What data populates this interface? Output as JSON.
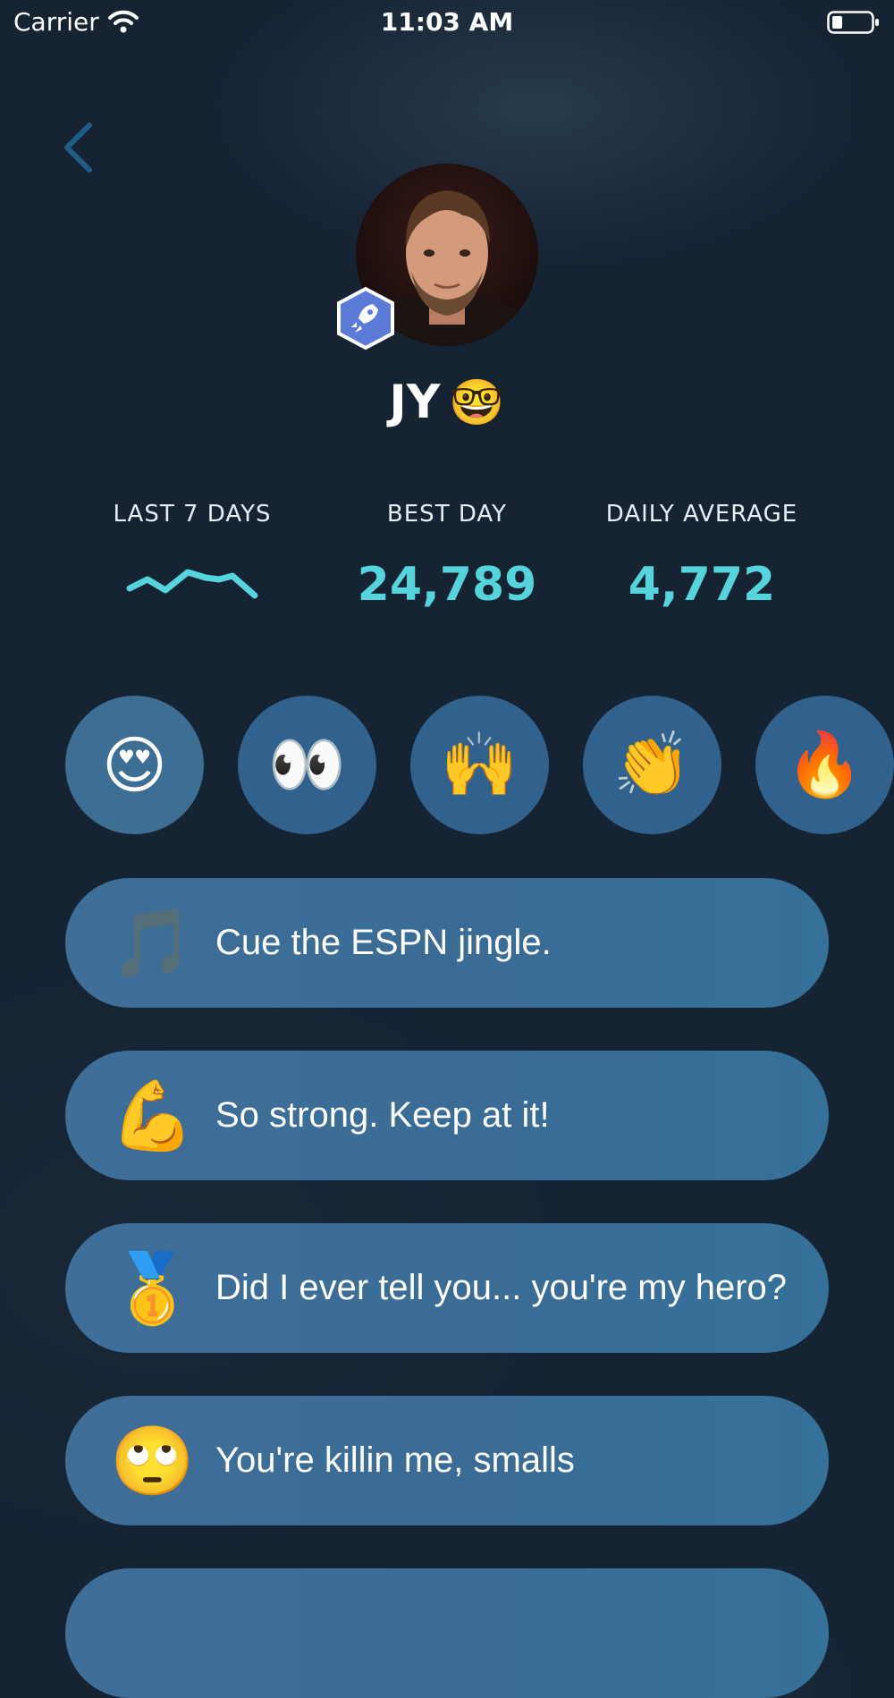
{
  "status_bar": {
    "carrier": "Carrier",
    "time": "11:03 AM"
  },
  "icons": {
    "back": "chevron-left-icon",
    "wifi": "wifi-icon",
    "battery": "battery-icon",
    "badge": "rocket-icon"
  },
  "profile": {
    "name": "JY",
    "name_emoji": "🤓"
  },
  "stats": {
    "last7_label": "LAST 7 DAYS",
    "best_label": "BEST DAY",
    "best_value": "24,789",
    "avg_label": "DAILY AVERAGE",
    "avg_value": "4,772"
  },
  "reactions": [
    "😍",
    "👀",
    "🙌",
    "👏",
    "🔥"
  ],
  "messages": [
    {
      "emoji": "🎵",
      "text": "Cue the ESPN jingle."
    },
    {
      "emoji": "💪",
      "text": "So strong. Keep at it!"
    },
    {
      "emoji": "🥇",
      "text": "Did I ever tell you... you're my hero?"
    },
    {
      "emoji": "🙄",
      "text": "You're killin me, smalls"
    }
  ],
  "colors": {
    "background": "#152333",
    "accent": "#55d4dc",
    "card": "#3a6c96",
    "reaction_bg": "#31628d",
    "back": "#1f5c86",
    "badge": "#5c7bd6"
  }
}
